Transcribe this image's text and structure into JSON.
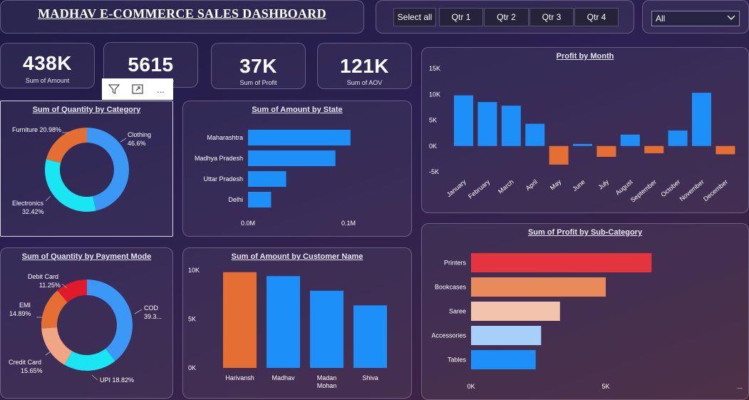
{
  "header": {
    "title": "MADHAV E-COMMERCE SALES DASHBOARD"
  },
  "slicer": {
    "buttons": [
      "Select all",
      "Qtr 1",
      "Qtr 2",
      "Qtr 3",
      "Qtr 4"
    ],
    "dropdown_value": "All"
  },
  "kpis": [
    {
      "value": "438K",
      "label": "Sum of Amount"
    },
    {
      "value": "5615",
      "label": "Sum of Quantity"
    },
    {
      "value": "37K",
      "label": "Sum of Profit"
    },
    {
      "value": "121K",
      "label": "Sum of AOV"
    }
  ],
  "visual_toolbar": {
    "filter_icon": "filter-icon",
    "focus_icon": "focus-mode-icon",
    "more_label": "..."
  },
  "chart_data": [
    {
      "id": "qty_by_category",
      "type": "pie",
      "title": "Sum of Quantity by Category",
      "labels": [
        "Clothing",
        "Electronics",
        "Furniture"
      ],
      "display": [
        "46.6%",
        "32.42%",
        "20.98%"
      ],
      "values": [
        46.6,
        32.42,
        20.98
      ],
      "colors": [
        "#3b98f4",
        "#19e6f3",
        "#e56e33"
      ]
    },
    {
      "id": "amount_by_state",
      "type": "bar",
      "title": "Sum of Amount by State",
      "categories": [
        "Maharashtra",
        "Madhya Pradesh",
        "Uttar Pradesh",
        "Delhi"
      ],
      "values": [
        0.102,
        0.087,
        0.038,
        0.023
      ],
      "xticks": [
        {
          "label": "0.0M",
          "value": 0
        },
        {
          "label": "0.1M",
          "value": 0.1
        }
      ],
      "xlim": [
        0,
        0.1
      ],
      "color": "#1d8ff8"
    },
    {
      "id": "profit_by_month",
      "type": "bar",
      "title": "Profit by Month",
      "categories": [
        "January",
        "February",
        "March",
        "April",
        "May",
        "June",
        "July",
        "August",
        "September",
        "October",
        "November",
        "December"
      ],
      "values": [
        9800,
        8500,
        7800,
        4300,
        -3600,
        400,
        -2100,
        2200,
        -1400,
        3000,
        10300,
        -1600
      ],
      "yticks": [
        {
          "label": "15K",
          "value": 15000
        },
        {
          "label": "10K",
          "value": 10000
        },
        {
          "label": "5K",
          "value": 5000
        },
        {
          "label": "0K",
          "value": 0
        },
        {
          "label": "-5K",
          "value": -5000
        }
      ],
      "ylim": [
        -5000,
        15000
      ],
      "pos_color": "#1d8ff8",
      "neg_color": "#e56e33"
    },
    {
      "id": "qty_by_payment",
      "type": "pie",
      "title": "Sum of Quantity by Payment Mode",
      "labels": [
        "COD",
        "UPI",
        "Credit Card",
        "EMI",
        "Debit Card"
      ],
      "display": [
        "39.3...",
        "18.82%",
        "15.65%",
        "14.89%",
        "11.25%"
      ],
      "values": [
        39.39,
        18.82,
        15.65,
        14.89,
        11.25
      ],
      "colors": [
        "#3b98f4",
        "#19e6f3",
        "#f0a583",
        "#e56e33",
        "#e0192b"
      ]
    },
    {
      "id": "amount_by_customer",
      "type": "bar",
      "title": "Sum of Amount by Customer Name",
      "categories": [
        "Harivansh",
        "Madhav",
        "Madan Mohan",
        "Shiva"
      ],
      "category_lines": [
        [
          "Harivansh"
        ],
        [
          "Madhav"
        ],
        [
          "Madan",
          "Mohan"
        ],
        [
          "Shiva"
        ]
      ],
      "values": [
        9800,
        9400,
        7900,
        6400
      ],
      "yticks": [
        {
          "label": "10K",
          "value": 10000
        },
        {
          "label": "5K",
          "value": 5000
        },
        {
          "label": "0K",
          "value": 0
        }
      ],
      "ylim": [
        0,
        10000
      ],
      "colors": [
        "#e56e33",
        "#1d8ff8",
        "#1d8ff8",
        "#1d8ff8"
      ]
    },
    {
      "id": "profit_by_subcategory",
      "type": "bar",
      "title": "Sum of Profit by Sub-Category",
      "categories": [
        "Printers",
        "Bookcases",
        "Saree",
        "Accessories",
        "Tables"
      ],
      "values": [
        6700,
        5000,
        3300,
        2600,
        2400
      ],
      "xticks": [
        {
          "label": "0K",
          "value": 0
        },
        {
          "label": "5K",
          "value": 5000
        }
      ],
      "overflow_label": "...",
      "xlim": [
        0,
        5000
      ],
      "colors": [
        "#e4343f",
        "#e98a5b",
        "#f2c3ad",
        "#a6cff9",
        "#1d8ff8"
      ]
    }
  ]
}
